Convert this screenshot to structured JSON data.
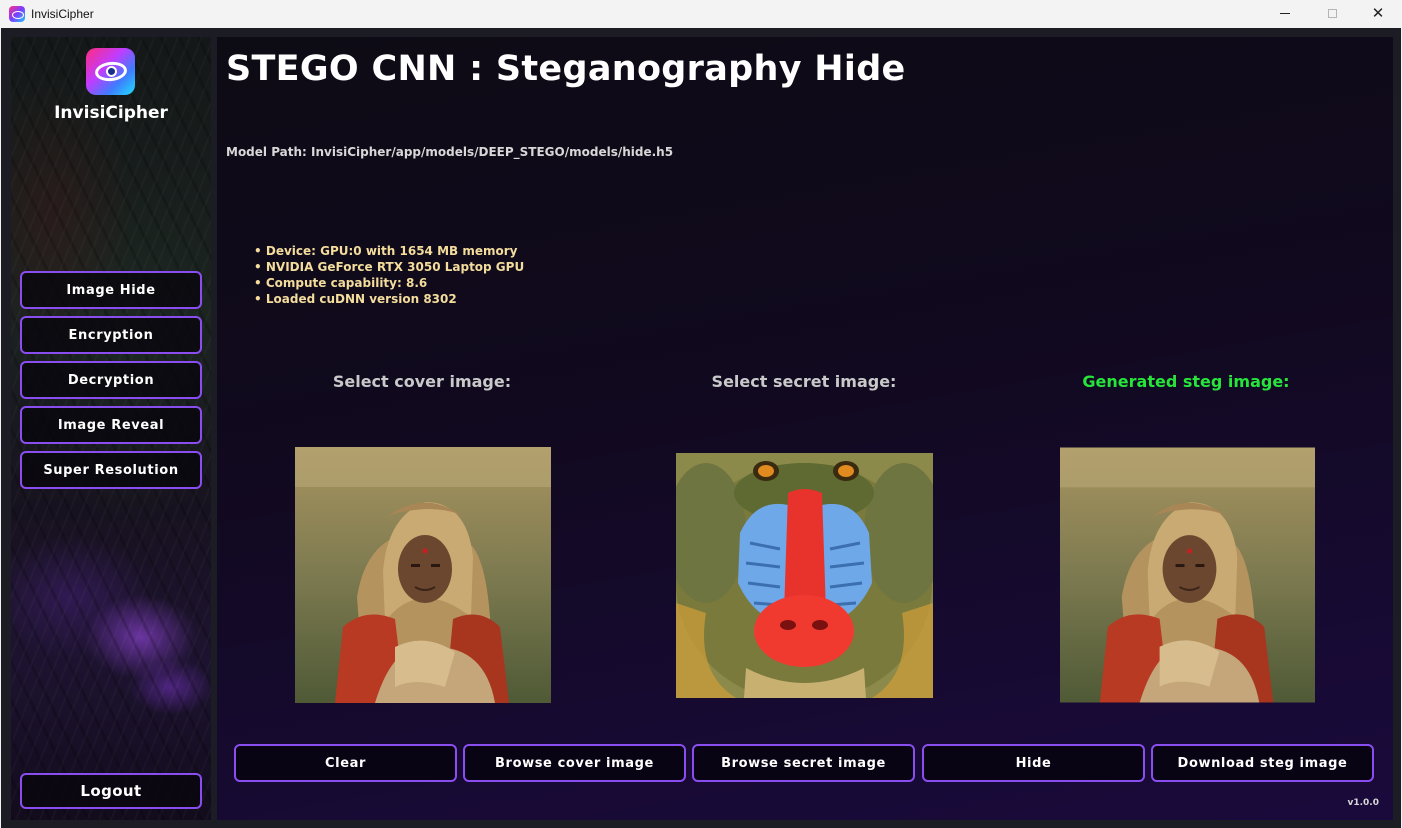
{
  "window": {
    "title": "InvisiCipher",
    "minimize_glyph": "",
    "maximize_glyph": "",
    "close_glyph": "✕"
  },
  "sidebar": {
    "logo_icon": "eye-icon",
    "brand": "InvisiCipher",
    "items": [
      {
        "label": "Image Hide"
      },
      {
        "label": "Encryption"
      },
      {
        "label": "Decryption"
      },
      {
        "label": "Image Reveal"
      },
      {
        "label": "Super Resolution"
      }
    ],
    "logout_label": "Logout"
  },
  "main": {
    "title": "STEGO CNN : Steganography Hide",
    "model_path": "Model Path: InvisiCipher/app/models/DEEP_STEGO/models/hide.h5",
    "device_info": [
      "Device: GPU:0 with 1654 MB memory",
      "NVIDIA GeForce RTX 3050 Laptop GPU",
      "Compute capability: 8.6",
      "Loaded cuDNN version 8302"
    ],
    "labels": {
      "cover": "Select cover image:",
      "secret": "Select secret image:",
      "steg": "Generated steg image:"
    },
    "buttons": {
      "clear": "Clear",
      "browse_cover": "Browse cover image",
      "browse_secret": "Browse secret image",
      "hide": "Hide",
      "download": "Download steg image"
    },
    "version": "v1.0.0"
  },
  "colors": {
    "accent_border": "#8a4df0",
    "steg_label": "#27e43a",
    "info_text": "#f3dc9c"
  }
}
